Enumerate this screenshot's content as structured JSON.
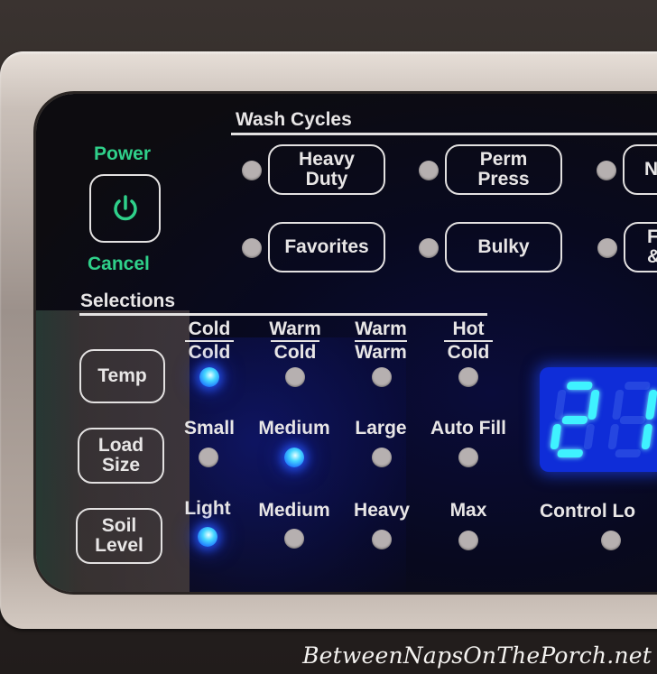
{
  "power": {
    "top_label": "Power",
    "bottom_label": "Cancel",
    "icon": "power-icon",
    "accent_color": "#2fd08a"
  },
  "wash_cycles": {
    "header": "Wash Cycles",
    "buttons": [
      {
        "label_line1": "Heavy",
        "label_line2": "Duty",
        "led_on": false
      },
      {
        "label_line1": "Perm",
        "label_line2": "Press",
        "led_on": false
      },
      {
        "label_line1": "N",
        "label_line2": "",
        "led_on": false
      },
      {
        "label_line1": "Favorites",
        "label_line2": "",
        "led_on": false
      },
      {
        "label_line1": "Bulky",
        "label_line2": "",
        "led_on": false
      },
      {
        "label_line1": "F",
        "label_line2": "&",
        "led_on": false
      }
    ]
  },
  "selections": {
    "header": "Selections",
    "temp": {
      "button_label": "Temp",
      "options": [
        {
          "wash": "Cold",
          "rinse": "Cold",
          "led_on": true
        },
        {
          "wash": "Warm",
          "rinse": "Cold",
          "led_on": false
        },
        {
          "wash": "Warm",
          "rinse": "Warm",
          "led_on": false
        },
        {
          "wash": "Hot",
          "rinse": "Cold",
          "led_on": false
        }
      ]
    },
    "load_size": {
      "button_line1": "Load",
      "button_line2": "Size",
      "options": [
        {
          "label": "Small",
          "led_on": false
        },
        {
          "label": "Medium",
          "led_on": true
        },
        {
          "label": "Large",
          "led_on": false
        },
        {
          "label": "Auto Fill",
          "led_on": false
        }
      ]
    },
    "soil_level": {
      "button_line1": "Soil",
      "button_line2": "Level",
      "options": [
        {
          "label": "Light",
          "led_on": true
        },
        {
          "label": "Medium",
          "led_on": false
        },
        {
          "label": "Heavy",
          "led_on": false
        },
        {
          "label": "Max",
          "led_on": false
        }
      ]
    }
  },
  "display": {
    "digits_visible": "21",
    "color": "#3ff2ff"
  },
  "control_lock": {
    "label": "Control Lo",
    "led_on": false
  },
  "watermark": "BetweenNapsOnThePorch.net",
  "led_on_color": "#1a6bff"
}
